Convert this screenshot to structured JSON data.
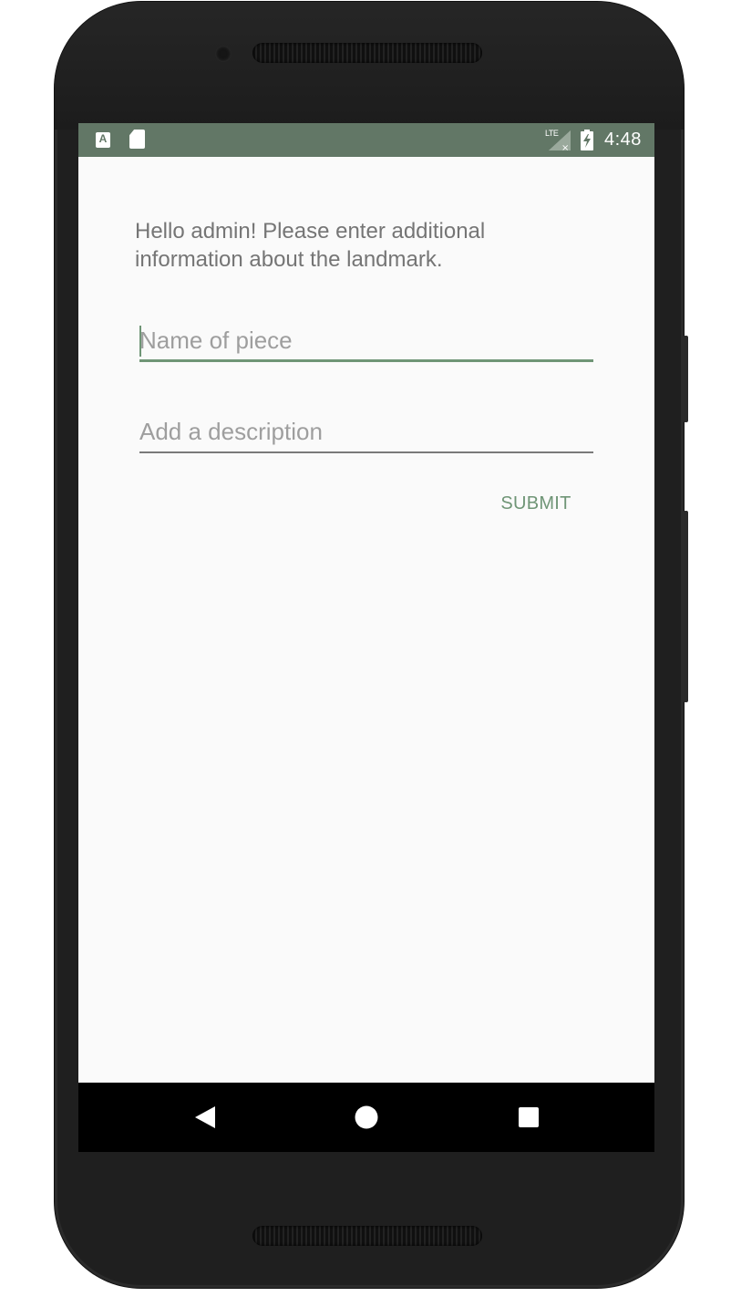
{
  "status_bar": {
    "time": "4:48",
    "network_label": "LTE",
    "keyboard_icon_letter": "A",
    "icons": [
      "keyboard-notification-icon",
      "sd-card-icon",
      "lte-signal-icon",
      "battery-charging-icon"
    ],
    "color": "#627766"
  },
  "form": {
    "intro_text": "Hello admin! Please enter additional information about the landmark.",
    "name_field": {
      "placeholder": "Name of piece",
      "value": ""
    },
    "description_field": {
      "placeholder": "Add a description",
      "value": ""
    },
    "submit_label": "SUBMIT",
    "accent_color": "#6f9576"
  },
  "nav_bar": {
    "buttons": [
      "back-icon",
      "home-icon",
      "recents-icon"
    ]
  }
}
